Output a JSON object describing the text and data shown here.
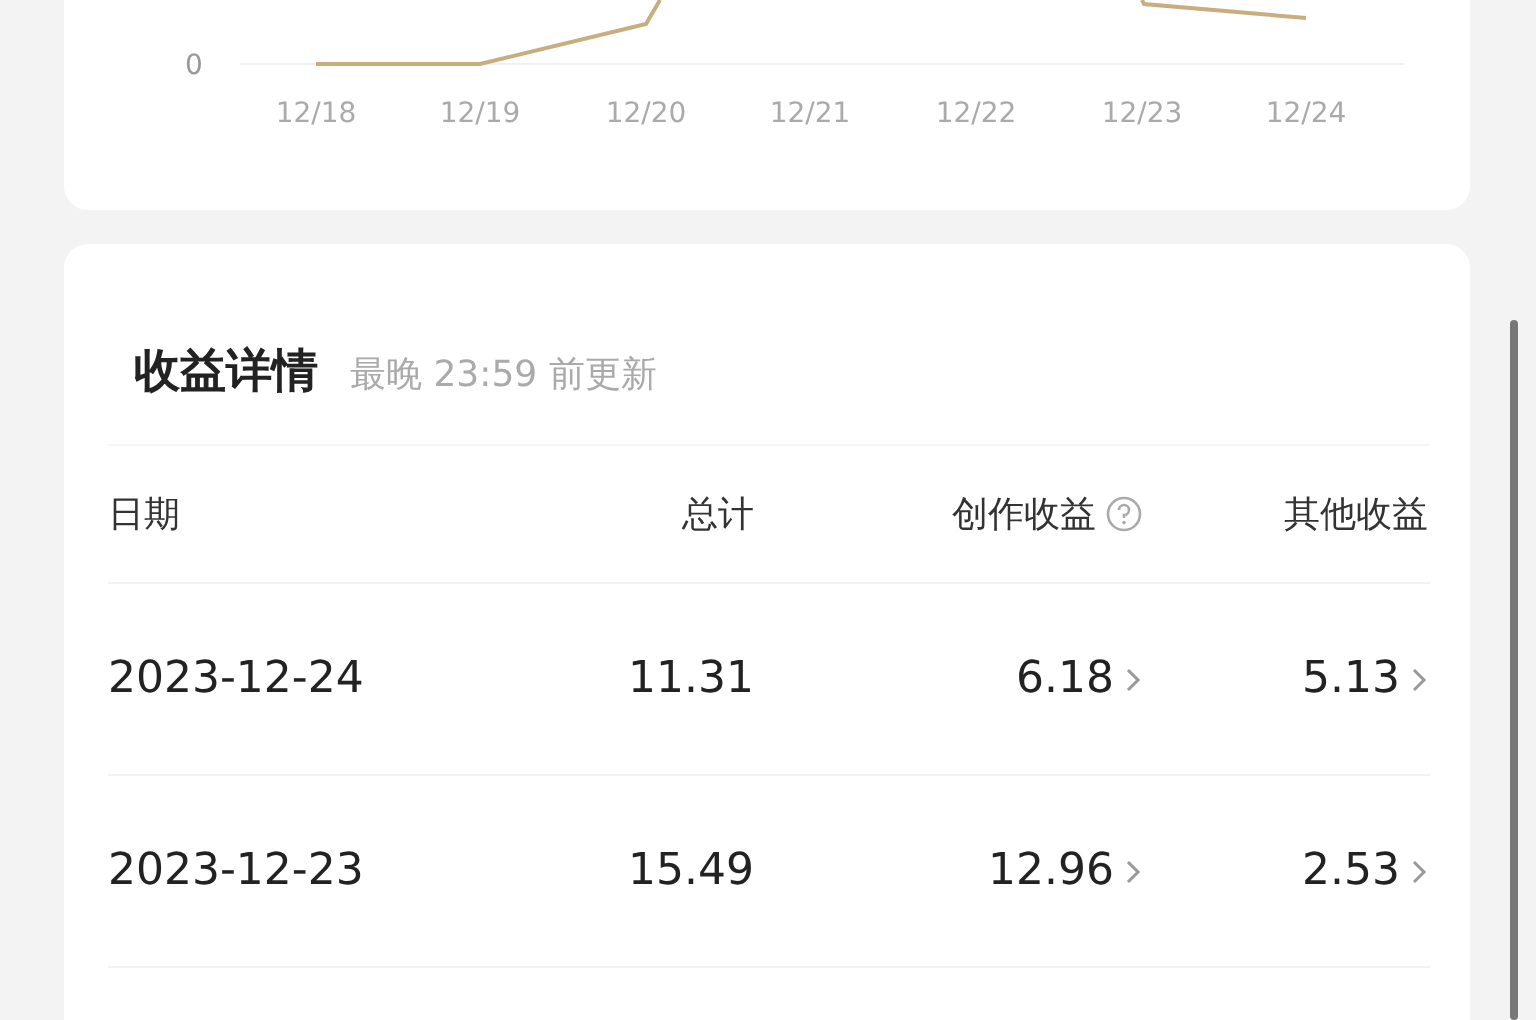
{
  "chart": {
    "y_tick": "0",
    "x_labels": [
      "12/18",
      "12/19",
      "12/20",
      "12/21",
      "12/22",
      "12/23",
      "12/24"
    ]
  },
  "details": {
    "title": "收益详情",
    "subtitle": "最晚 23:59 前更新",
    "columns": [
      {
        "label": "日期",
        "help": false
      },
      {
        "label": "总计",
        "help": false
      },
      {
        "label": "创作收益",
        "help": true
      },
      {
        "label": "其他收益",
        "help": false
      }
    ],
    "rows": [
      {
        "date": "2023-12-24",
        "total": "11.31",
        "creation": "6.18",
        "other": "5.13"
      },
      {
        "date": "2023-12-23",
        "total": "15.49",
        "creation": "12.96",
        "other": "2.53"
      }
    ]
  }
}
